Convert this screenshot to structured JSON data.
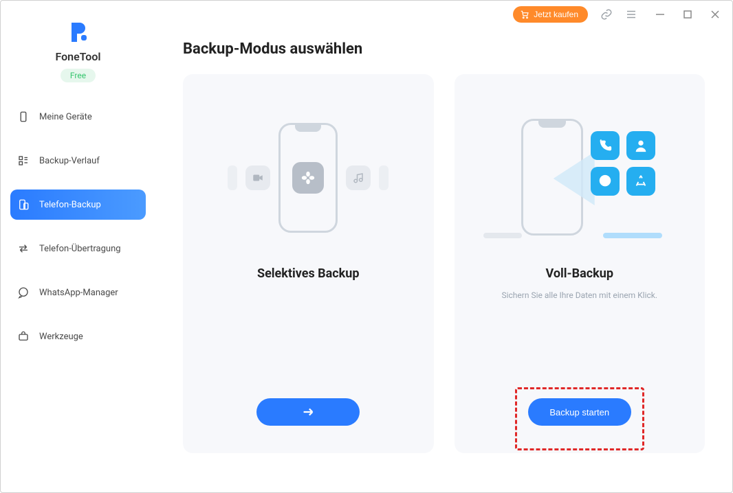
{
  "app": {
    "name": "FoneTool",
    "badge": "Free"
  },
  "titlebar": {
    "buy_label": "Jetzt kaufen"
  },
  "sidebar": {
    "items": [
      {
        "label": "Meine Geräte",
        "active": false
      },
      {
        "label": "Backup-Verlauf",
        "active": false
      },
      {
        "label": "Telefon-Backup",
        "active": true
      },
      {
        "label": "Telefon-Übertragung",
        "active": false
      },
      {
        "label": "WhatsApp-Manager",
        "active": false
      },
      {
        "label": "Werkzeuge",
        "active": false
      }
    ]
  },
  "main": {
    "title": "Backup-Modus auswählen",
    "cards": {
      "selective": {
        "title": "Selektives Backup"
      },
      "full": {
        "title": "Voll-Backup",
        "subtitle": "Sichern Sie alle Ihre Daten mit einem Klick.",
        "button_label": "Backup starten"
      }
    }
  }
}
